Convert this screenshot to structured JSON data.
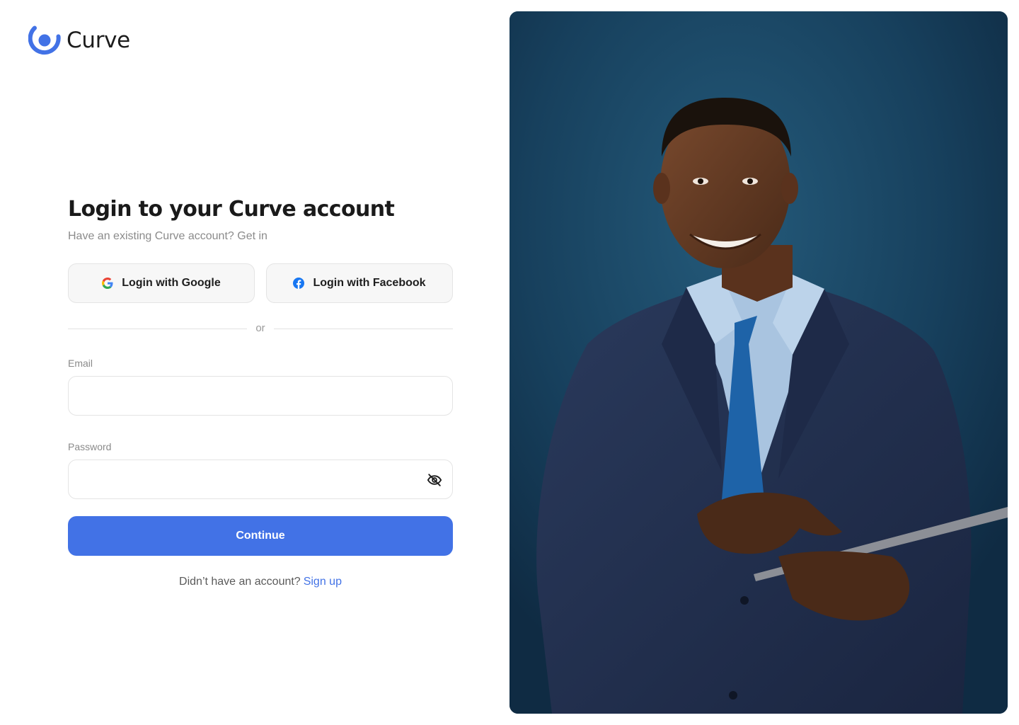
{
  "brand": {
    "name": "Curve",
    "accent_color": "#4272e6"
  },
  "login": {
    "title": "Login to your Curve account",
    "subtitle": "Have an existing Curve account? Get in",
    "google_label": "Login with Google",
    "facebook_label": "Login with Facebook",
    "divider_text": "or",
    "email_label": "Email",
    "email_value": "",
    "password_label": "Password",
    "password_value": "",
    "continue_label": "Continue",
    "signup_prompt": "Didn’t have an account?",
    "signup_link": "Sign up"
  },
  "icons": {
    "logo": "curve-logo-icon",
    "google": "google-icon",
    "facebook": "facebook-icon",
    "password_toggle": "eye-off-icon"
  },
  "hero": {
    "subject": "smiling man in navy suit holding tablet",
    "background_color": "#173f5c"
  }
}
